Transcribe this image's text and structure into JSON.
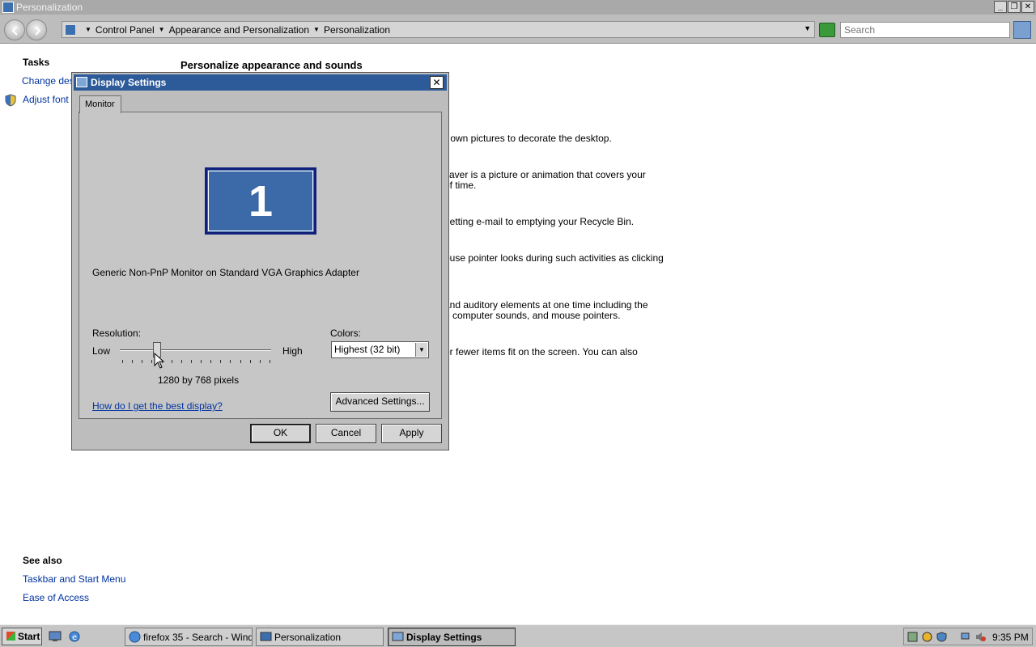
{
  "window": {
    "title": "Personalization",
    "controls": {
      "minimize": "_",
      "maximize": "❐",
      "close": "✕"
    }
  },
  "addressbar": {
    "crumbs": [
      "Control Panel",
      "Appearance and Personalization",
      "Personalization"
    ],
    "search_placeholder": "Search"
  },
  "left_panel": {
    "tasks_heading": "Tasks",
    "tasks": [
      "Change desk",
      "Adjust font si"
    ],
    "see_also_heading": "See also",
    "see_also": [
      "Taskbar and Start Menu",
      "Ease of Access"
    ]
  },
  "main": {
    "heading": "Personalize appearance and sounds",
    "fragments": [
      "r own pictures to decorate the desktop.",
      "saver is a picture or animation that covers your",
      "of time.",
      "getting e-mail to emptying your Recycle Bin.",
      "ouse pointer looks during such activities as clicking",
      "and auditory elements at one time including the",
      "e computer sounds, and mouse pointers.",
      "or fewer items fit on the screen. You can also"
    ]
  },
  "dialog": {
    "title": "Display Settings",
    "close": "✕",
    "tab": "Monitor",
    "monitor_number": "1",
    "monitor_name": "Generic Non-PnP Monitor on Standard VGA Graphics Adapter",
    "resolution_label": "Resolution:",
    "low_label": "Low",
    "high_label": "High",
    "resolution_value": "1280 by 768 pixels",
    "slider_position": 0.25,
    "colors_label": "Colors:",
    "colors_value": "Highest (32 bit)",
    "help_link": "How do I get the best display?",
    "advanced_button": "Advanced Settings...",
    "ok_button": "OK",
    "cancel_button": "Cancel",
    "apply_button": "Apply"
  },
  "taskbar": {
    "start": "Start",
    "items": [
      "firefox 35 - Search - Wind...",
      "Personalization",
      "Display Settings"
    ],
    "active_item": "Display Settings",
    "clock": "9:35 PM"
  }
}
